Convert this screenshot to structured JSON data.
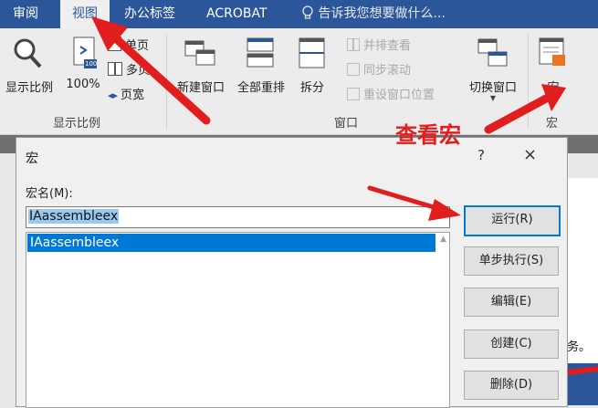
{
  "ribbon_tabs": {
    "review": "审阅",
    "view": "视图",
    "office_tab": "办公标签",
    "acrobat": "ACROBAT",
    "tell_me": "告诉我您想要做什么..."
  },
  "ribbon": {
    "zoom_label": "显示比例",
    "zoom100_label": "100%",
    "zoom100_badge": "100",
    "one_page": "单页",
    "multi_page": "多页",
    "page_width": "页宽",
    "zoom_group": "显示比例",
    "new_window": "新建窗口",
    "arrange_all": "全部重排",
    "split": "拆分",
    "view_side_by_side": "并排查看",
    "sync_scroll": "同步滚动",
    "reset_window": "重设窗口位置",
    "switch_windows": "切换窗口",
    "window_group": "窗口",
    "macros": "宏",
    "macros_group": "宏"
  },
  "annotation": "查看宏",
  "dialog": {
    "title": "宏",
    "help": "?",
    "close": "×",
    "macro_name_label": "宏名(M):",
    "macro_name_value": "IAassembleex",
    "macros": [
      "IAassembleex"
    ],
    "buttons": {
      "run": "运行(R)",
      "step_into": "单步执行(S)",
      "edit": "编辑(E)",
      "create": "创建(C)",
      "delete": "删除(D)"
    }
  },
  "background_text": "务。",
  "colors": {
    "title_bar": "#2b579a",
    "annotation_red": "#e11d1d",
    "selection": "#0078d7",
    "default_button_border": "#0078d7"
  }
}
